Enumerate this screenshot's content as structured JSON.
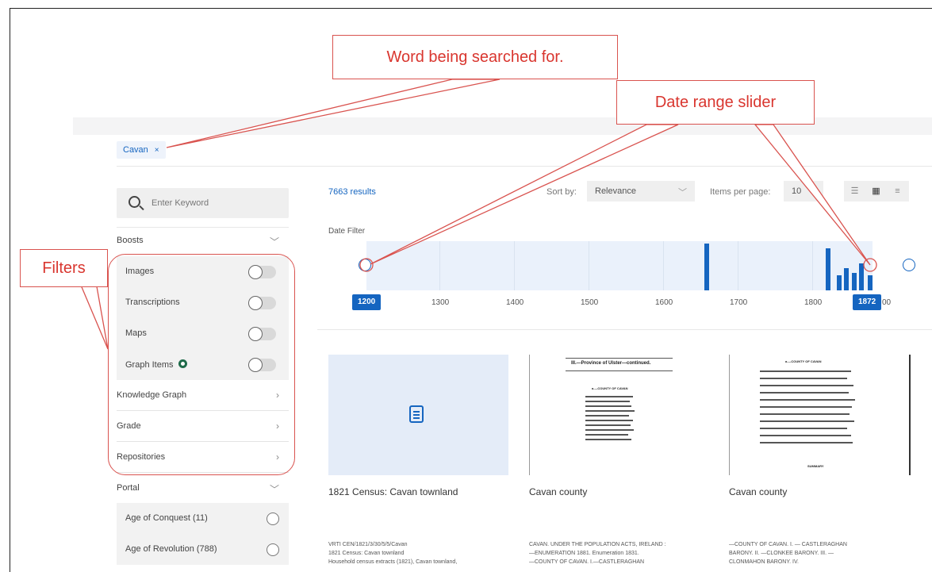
{
  "search": {
    "chip_label": "Cavan",
    "chip_remove": "×"
  },
  "sidebar": {
    "keyword_placeholder": "Enter Keyword",
    "boosts_label": "Boosts",
    "boosts": [
      {
        "label": "Images",
        "on": false
      },
      {
        "label": "Transcriptions",
        "on": false
      },
      {
        "label": "Maps",
        "on": false
      },
      {
        "label": "Graph Items",
        "on": false
      }
    ],
    "sections": [
      "Knowledge Graph",
      "Grade",
      "Repositories"
    ],
    "portal_label": "Portal",
    "portal_items": [
      "Age of Conquest (11)",
      "Age of Revolution (788)"
    ]
  },
  "results": {
    "count": "7663 results",
    "sort_label": "Sort by:",
    "sort_value": "Relevance",
    "ipp_label": "Items per page:",
    "ipp_value": "10",
    "view_icons": [
      "list-icon",
      "grid-icon",
      "compact-list-icon"
    ]
  },
  "date_filter": {
    "label": "Date Filter",
    "range": [
      1200,
      1900
    ],
    "ticks": [
      "1300",
      "1400",
      "1500",
      "1600",
      "1700",
      "1800"
    ],
    "end_tick_fragment": "00",
    "min_value": "1200",
    "max_value": "1872",
    "histogram": [
      {
        "year": 1658,
        "level": 0.95
      },
      {
        "year": 1821,
        "level": 0.85
      },
      {
        "year": 1836,
        "level": 0.3
      },
      {
        "year": 1846,
        "level": 0.45
      },
      {
        "year": 1856,
        "level": 0.35
      },
      {
        "year": 1866,
        "level": 0.55
      },
      {
        "year": 1878,
        "level": 0.3
      }
    ],
    "accent": "#1565c0"
  },
  "cards": [
    {
      "title": "1821 Census: Cavan townland",
      "desc_lines": [
        "VRTI CEN/1821/3/30/5/5/Cavan",
        "1821 Census: Cavan townland",
        "Household census extracts (1821), Cavan townland,"
      ]
    },
    {
      "title": "Cavan county",
      "scan_heading": "III.—Province of Ulster—continued.",
      "scan_subheading": "a.—COUNTY OF CAVAN",
      "desc_lines": [
        "CAVAN. UNDER THE POPULATION ACTS, IRELAND :",
        "—ENUMERATION 1881. Enumeration 1831.",
        "—COUNTY OF CAVAN. I.—CASTLERAGHAN"
      ]
    },
    {
      "title": "Cavan county",
      "scan_heading": "a.—COUNTY OF CAVAN",
      "scan_footer": "SUMMARY",
      "desc_lines": [
        "—COUNTY OF CAVAN. I. — CASTLERAGHAN",
        "BARONY. II. —CLONKEE BARONY. III. —",
        "CLONMAHON BARONY. IV."
      ]
    }
  ],
  "annotations": {
    "search_word": "Word being searched for.",
    "date_slider": "Date range slider",
    "filters": "Filters",
    "color": "#d9534f"
  }
}
